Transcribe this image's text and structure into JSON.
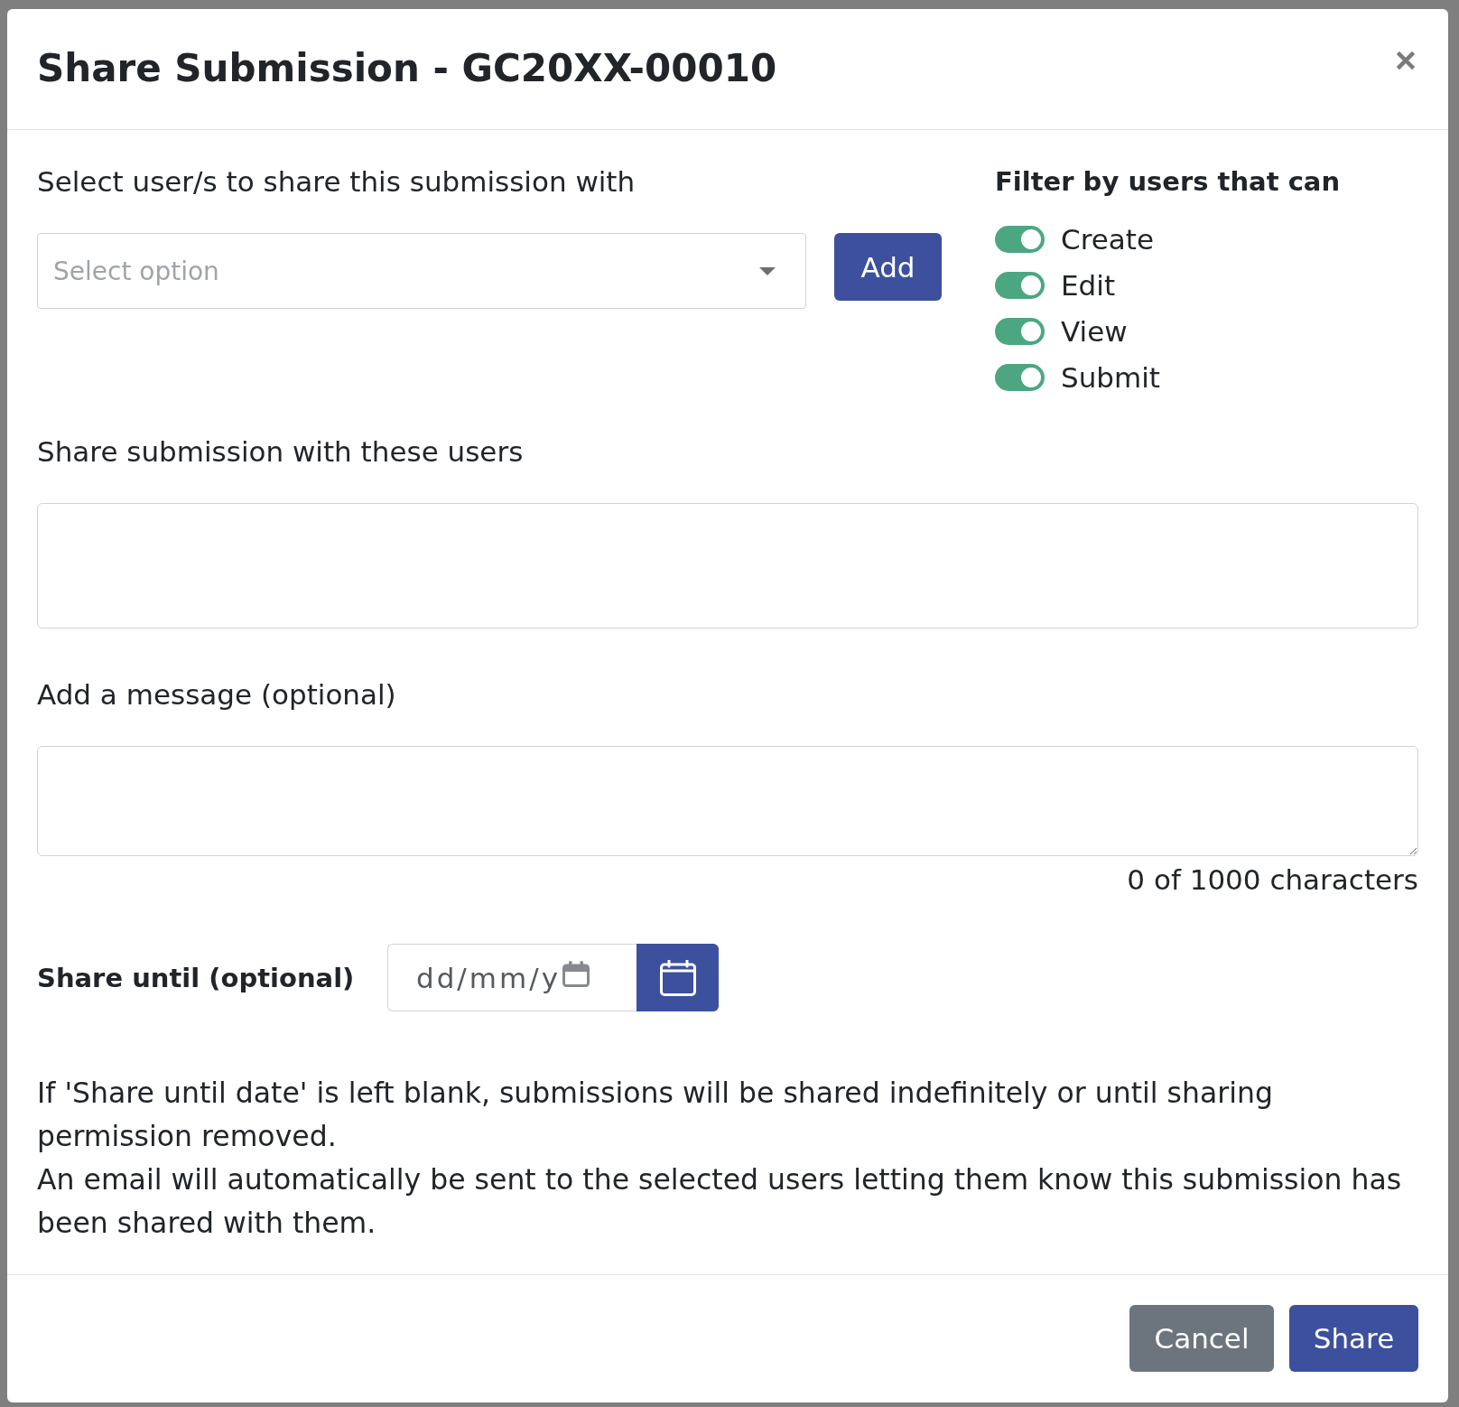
{
  "dialog": {
    "title": "Share Submission - GC20XX-00010"
  },
  "user_picker": {
    "label": "Select user/s to share this submission with",
    "placeholder": "Select option",
    "add_button": "Add"
  },
  "filter": {
    "heading": "Filter by users that can",
    "options": [
      {
        "label": "Create",
        "on": true
      },
      {
        "label": "Edit",
        "on": true
      },
      {
        "label": "View",
        "on": true
      },
      {
        "label": "Submit",
        "on": true
      }
    ]
  },
  "shared_users": {
    "label": "Share submission with these users"
  },
  "message": {
    "label": "Add a message (optional)",
    "counter": "0 of 1000 characters"
  },
  "share_until": {
    "label": "Share until (optional)",
    "placeholder": "dd/mm/y"
  },
  "notes": [
    "If 'Share until date' is left blank, submissions will be shared indefinitely or until sharing permission removed.",
    "An email will automatically be sent to the selected users letting them know this submission has been shared with them."
  ],
  "footer": {
    "buttons": [
      {
        "label": "Cancel",
        "kind": "secondary"
      },
      {
        "label": "Share",
        "kind": "primary"
      }
    ]
  }
}
